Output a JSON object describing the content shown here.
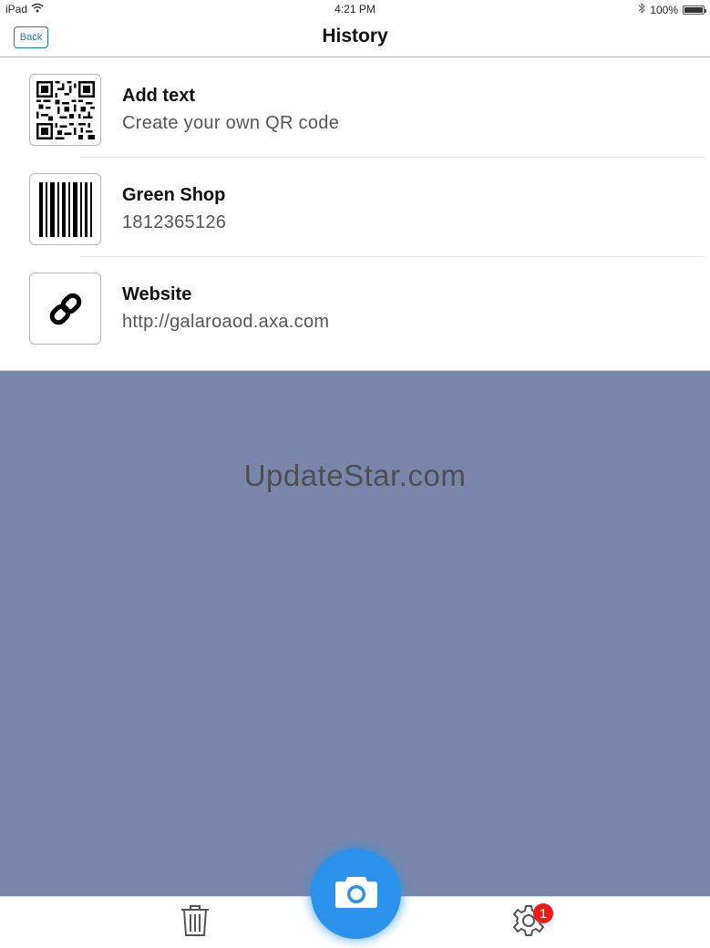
{
  "status_bar": {
    "device": "iPad",
    "time": "4:21 PM",
    "battery_percent": "100%"
  },
  "nav": {
    "back_label": "Back",
    "title": "History"
  },
  "history": [
    {
      "title": "Add text",
      "subtitle": "Create your own QR code",
      "icon": "qr-code-icon"
    },
    {
      "title": "Green Shop",
      "subtitle": "1812365126",
      "icon": "barcode-icon"
    },
    {
      "title": "Website",
      "subtitle": "http://galaroaod.axa.com",
      "icon": "link-icon"
    }
  ],
  "scan_area": {
    "watermark": "UpdateStar.com"
  },
  "tab_bar": {
    "settings_badge": "1",
    "icons": [
      "trash-icon",
      "camera-icon",
      "gear-icon"
    ]
  },
  "colors": {
    "accent": "#2a92ea",
    "back_button": "#1a7fae",
    "scan_background": "#7887a9",
    "badge": "#f01a14"
  }
}
